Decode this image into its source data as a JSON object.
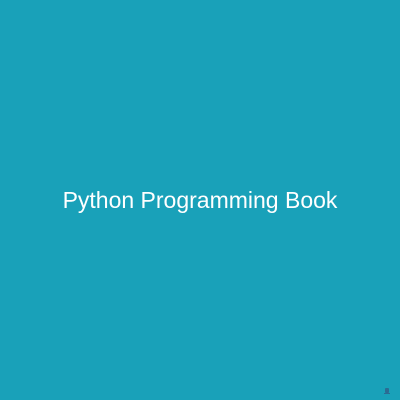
{
  "placeholder": {
    "title": "Python Programming Book",
    "background_color": "#19a1b9",
    "text_color": "#ffffff",
    "corner_icon": "watermark-icon"
  }
}
